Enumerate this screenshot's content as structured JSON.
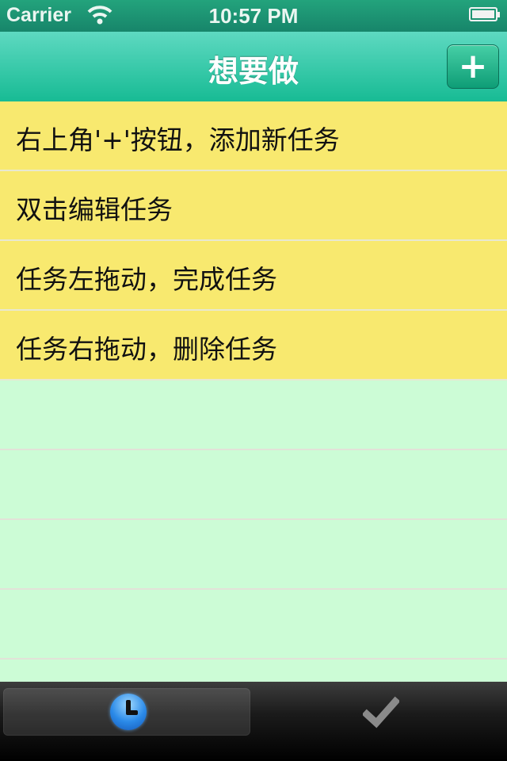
{
  "status_bar": {
    "carrier": "Carrier",
    "time": "10:57 PM",
    "icons": [
      "wifi-icon",
      "battery-icon"
    ]
  },
  "nav_bar": {
    "title": "想要做",
    "add_button_label": "+"
  },
  "tasks": [
    {
      "label": "右上角'+'按钮，添加新任务"
    },
    {
      "label": "双击编辑任务"
    },
    {
      "label": "任务左拖动，完成任务"
    },
    {
      "label": "任务右拖动，删除任务"
    }
  ],
  "tab_bar": {
    "tabs": [
      {
        "icon": "clock-icon",
        "selected": true
      },
      {
        "icon": "checkmark-icon",
        "selected": false
      }
    ]
  },
  "colors": {
    "nav_green": "#17bb94",
    "task_yellow": "#f8e96f",
    "empty_row_green": "#ccfcd6"
  }
}
